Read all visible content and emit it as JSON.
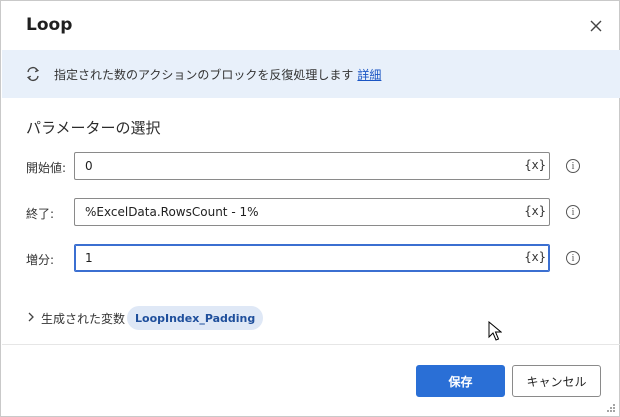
{
  "dialog": {
    "title": "Loop",
    "close_icon": "close-icon"
  },
  "banner": {
    "icon": "loop-icon",
    "text": "指定された数のアクションのブロックを反復処理します",
    "link": "詳細"
  },
  "section": {
    "title": "パラメーターの選択"
  },
  "fields": {
    "start": {
      "label": "開始値:",
      "value": "0",
      "var_button": "{x}",
      "info": "i"
    },
    "end": {
      "label": "終了:",
      "value": "%ExcelData.RowsCount - 1%",
      "var_button": "{x}",
      "info": "i"
    },
    "step": {
      "label": "増分:",
      "value": "1",
      "var_button": "{x}",
      "info": "i"
    }
  },
  "variables": {
    "label": "生成された変数",
    "chip": "LoopIndex_Padding"
  },
  "footer": {
    "save": "保存",
    "cancel": "キャンセル"
  },
  "colors": {
    "accent": "#2a6fd6",
    "banner_bg": "#e8f0fa",
    "chip_bg": "#dfe8f6",
    "focus_border": "#3b6fd1"
  }
}
